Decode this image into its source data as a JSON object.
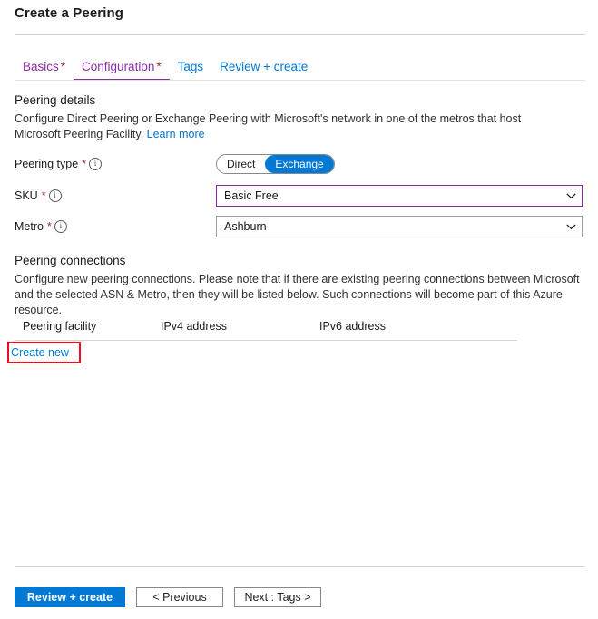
{
  "blade": {
    "title": "Create a Peering"
  },
  "tabs": [
    {
      "label": "Basics",
      "required": "*",
      "state": "visited"
    },
    {
      "label": "Configuration",
      "required": "*",
      "state": "active"
    },
    {
      "label": "Tags",
      "required": "",
      "state": "link"
    },
    {
      "label": "Review + create",
      "required": "",
      "state": "link"
    }
  ],
  "peering_details": {
    "heading": "Peering details",
    "description": "Configure Direct Peering or Exchange Peering with Microsoft's network in one of the metros that host Microsoft Peering Facility.",
    "learn_more": "Learn more"
  },
  "fields": {
    "peering_type": {
      "label": "Peering type",
      "required": "*",
      "info_icon": "info-icon",
      "options": [
        "Direct",
        "Exchange"
      ],
      "selected": "Exchange"
    },
    "sku": {
      "label": "SKU",
      "required": "*",
      "info_icon": "info-icon",
      "value": "Basic Free",
      "chevron_icon": "chevron-down-icon"
    },
    "metro": {
      "label": "Metro",
      "required": "*",
      "info_icon": "info-icon",
      "value": "Ashburn",
      "chevron_icon": "chevron-down-icon"
    }
  },
  "peering_connections": {
    "heading": "Peering connections",
    "description": "Configure new peering connections. Please note that if there are existing peering connections between Microsoft and the selected ASN & Metro, then they will be listed below. Such connections will become part of this Azure resource.",
    "columns": [
      "Peering facility",
      "IPv4 address",
      "IPv6 address"
    ],
    "rows": [],
    "create_new": "Create new"
  },
  "footer": {
    "review_create": "Review + create",
    "previous": "< Previous",
    "next": "Next : Tags >"
  },
  "colors": {
    "accent_blue": "#0078d4",
    "visited_purple": "#8a2da5",
    "required_red": "#a4262c",
    "highlight_red": "#e81123"
  }
}
